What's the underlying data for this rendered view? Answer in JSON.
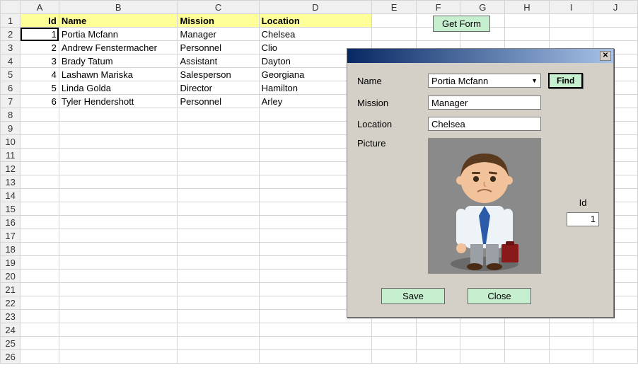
{
  "columns": [
    "A",
    "B",
    "C",
    "D",
    "E",
    "F",
    "G",
    "H",
    "I",
    "J"
  ],
  "row_count": 26,
  "headers": {
    "id": "Id",
    "name": "Name",
    "mission": "Mission",
    "location": "Location"
  },
  "rows": [
    {
      "id": "1",
      "name": "Portia Mcfann",
      "mission": "Manager",
      "location": "Chelsea"
    },
    {
      "id": "2",
      "name": "Andrew Fenstermacher",
      "mission": "Personnel",
      "location": "Clio"
    },
    {
      "id": "3",
      "name": "Brady Tatum",
      "mission": "Assistant",
      "location": "Dayton"
    },
    {
      "id": "4",
      "name": "Lashawn Mariska",
      "mission": "Salesperson",
      "location": "Georgiana"
    },
    {
      "id": "5",
      "name": "Linda Golda",
      "mission": "Director",
      "location": "Hamilton"
    },
    {
      "id": "6",
      "name": "Tyler Hendershott",
      "mission": "Personnel",
      "location": "Arley"
    }
  ],
  "getform_label": "Get Form",
  "dialog": {
    "labels": {
      "name": "Name",
      "mission": "Mission",
      "location": "Location",
      "picture": "Picture",
      "id": "Id"
    },
    "values": {
      "name": "Portia Mcfann",
      "mission": "Manager",
      "location": "Chelsea",
      "id": "1"
    },
    "buttons": {
      "find": "Find",
      "save": "Save",
      "close": "Close"
    }
  }
}
